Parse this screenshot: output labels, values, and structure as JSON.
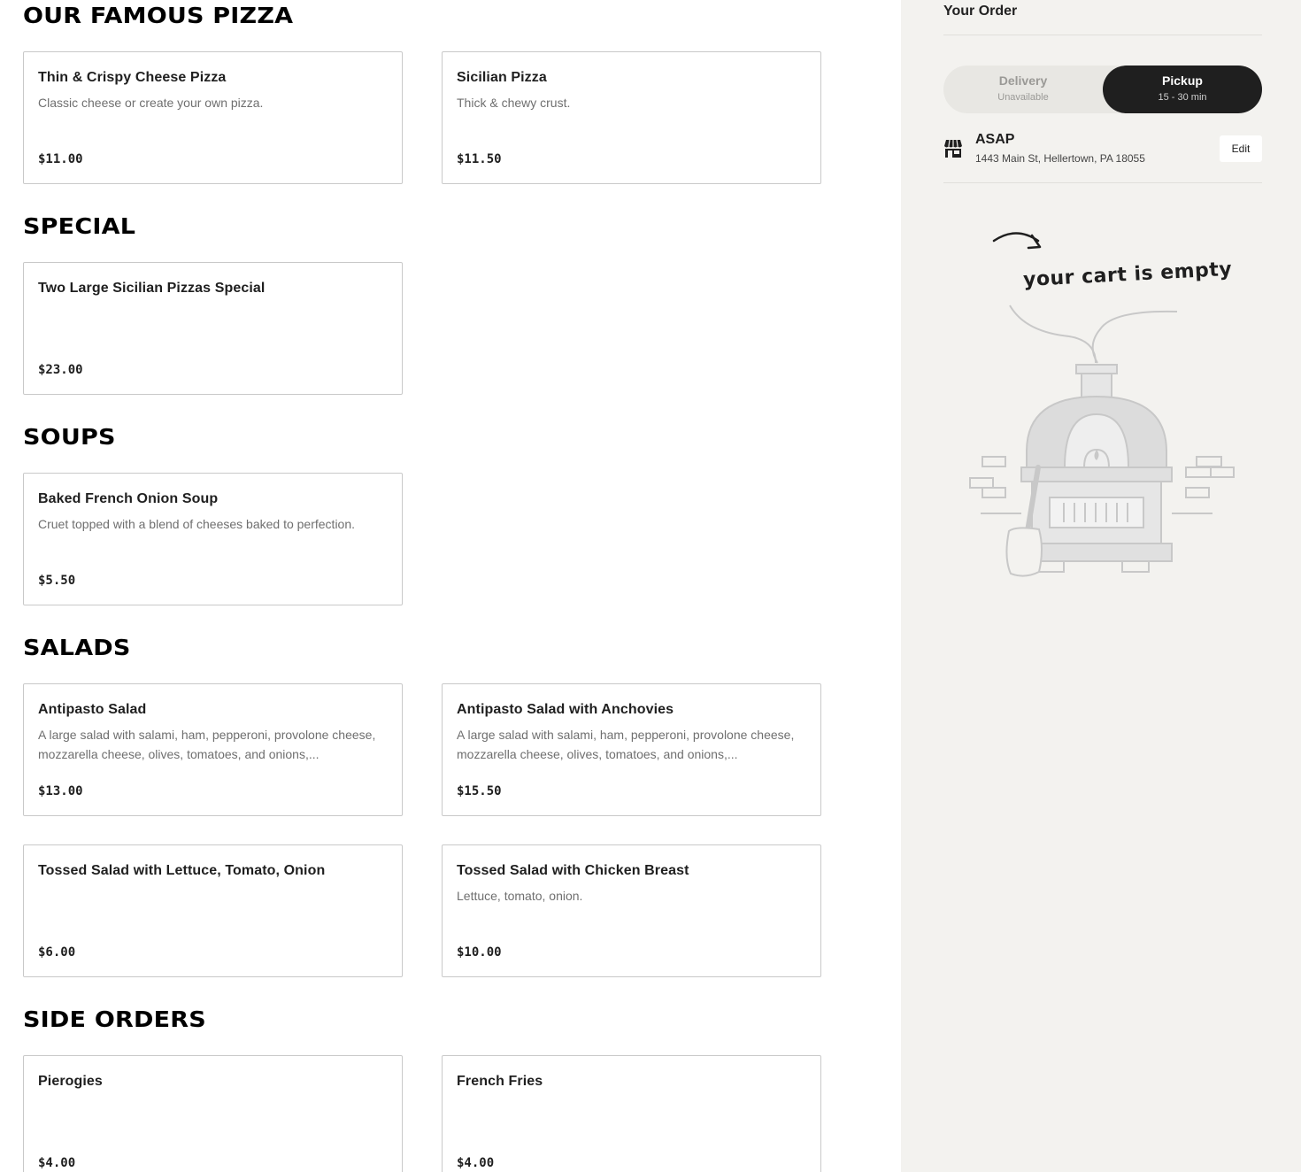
{
  "menu": {
    "sections": [
      {
        "title": "OUR FAMOUS PIZZA",
        "items": [
          {
            "name": "Thin & Crispy Cheese Pizza",
            "desc": "Classic cheese or create your own pizza.",
            "price": "$11.00"
          },
          {
            "name": "Sicilian Pizza",
            "desc": "Thick & chewy crust.",
            "price": "$11.50"
          }
        ]
      },
      {
        "title": "SPECIAL",
        "items": [
          {
            "name": "Two Large Sicilian Pizzas Special",
            "desc": "",
            "price": "$23.00"
          }
        ]
      },
      {
        "title": "SOUPS",
        "items": [
          {
            "name": "Baked French Onion Soup",
            "desc": "Cruet topped with a blend of cheeses baked to perfection.",
            "price": "$5.50"
          }
        ]
      },
      {
        "title": "SALADS",
        "items": [
          {
            "name": "Antipasto Salad",
            "desc": "A large salad with salami, ham, pepperoni, provolone cheese, mozzarella cheese, olives, tomatoes, and onions,...",
            "price": "$13.00"
          },
          {
            "name": "Antipasto Salad with Anchovies",
            "desc": "A large salad with salami, ham, pepperoni, provolone cheese, mozzarella cheese, olives, tomatoes, and onions,...",
            "price": "$15.50"
          },
          {
            "name": "Tossed Salad with Lettuce, Tomato, Onion",
            "desc": "",
            "price": "$6.00"
          },
          {
            "name": "Tossed Salad with Chicken Breast",
            "desc": "Lettuce, tomato, onion.",
            "price": "$10.00"
          }
        ]
      },
      {
        "title": "SIDE ORDERS",
        "items": [
          {
            "name": "Pierogies",
            "desc": "",
            "price": "$4.00"
          },
          {
            "name": "French Fries",
            "desc": "",
            "price": "$4.00"
          }
        ]
      }
    ]
  },
  "order": {
    "title": "Your Order",
    "delivery": {
      "label": "Delivery",
      "sub": "Unavailable"
    },
    "pickup": {
      "label": "Pickup",
      "sub": "15 - 30 min",
      "selected": true
    },
    "time": "ASAP",
    "address": "1443 Main St, Hellertown, PA 18055",
    "edit_label": "Edit",
    "empty_message": "your cart is empty"
  },
  "colors": {
    "sidebar_bg": "#f3f2ef",
    "selected_toggle": "#1f1f1f",
    "card_border": "#c9c9c9"
  }
}
